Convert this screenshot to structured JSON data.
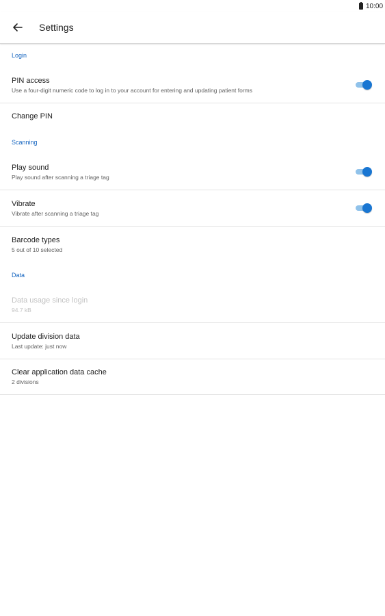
{
  "status_bar": {
    "time": "10:00",
    "battery_icon": "battery-icon"
  },
  "app_bar": {
    "title": "Settings",
    "back_icon": "arrow-back-icon"
  },
  "sections": {
    "login": "Login",
    "scanning": "Scanning",
    "data": "Data"
  },
  "settings": {
    "pin_access": {
      "title": "PIN access",
      "summary": "Use a four-digit numeric code to log in to your account for entering and updating patient forms",
      "enabled": true
    },
    "change_pin": {
      "title": "Change PIN"
    },
    "play_sound": {
      "title": "Play sound",
      "summary": "Play sound after scanning a triage tag",
      "enabled": true
    },
    "vibrate": {
      "title": "Vibrate",
      "summary": "Vibrate after scanning a triage tag",
      "enabled": true
    },
    "barcode_types": {
      "title": "Barcode types",
      "summary": "5 out of 10 selected"
    },
    "data_usage": {
      "title": "Data usage since login",
      "summary": "94.7 kB"
    },
    "update_division": {
      "title": "Update division data",
      "summary": "Last update: just now"
    },
    "clear_cache": {
      "title": "Clear application data cache",
      "summary": "2 divisions"
    }
  },
  "colors": {
    "accent": "#1976d2",
    "section_text": "#1565c0",
    "toggle_track": "#90c2ea",
    "disabled_text": "#c2c2c2"
  }
}
